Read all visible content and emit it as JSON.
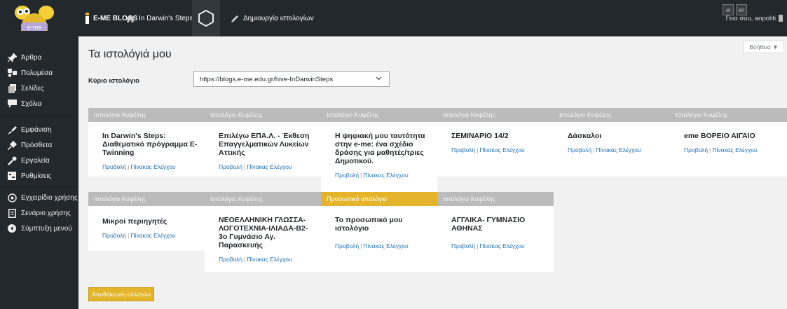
{
  "topbar": {
    "logo_text": "e-me",
    "blogs_label": "E-ME BLOGS",
    "site_label": "In Darwin's Steps: Δ...",
    "create_label": "Δημιουργία ιστολογίων",
    "lang_el": "el",
    "lang_en": "en",
    "greeting": "Γεια σου, anpoliti"
  },
  "sidebar": {
    "items": [
      {
        "label": "Άρθρα",
        "icon": "pin-icon"
      },
      {
        "label": "Πολυμέσα",
        "icon": "media-icon"
      },
      {
        "label": "Σελίδες",
        "icon": "pages-icon"
      },
      {
        "label": "Σχόλια",
        "icon": "comments-icon"
      },
      {
        "label": "Εμφάνιση",
        "icon": "appearance-icon"
      },
      {
        "label": "Πρόσθετα",
        "icon": "plugins-icon"
      },
      {
        "label": "Εργαλεία",
        "icon": "tools-icon"
      },
      {
        "label": "Ρυθμίσεις",
        "icon": "settings-icon"
      },
      {
        "label": "Εγχειρίδιο χρήσης",
        "icon": "help-icon"
      },
      {
        "label": "Σενάριο χρήσης",
        "icon": "scenario-icon"
      },
      {
        "label": "Σύμπτυξη μενού",
        "icon": "collapse-icon"
      }
    ]
  },
  "main": {
    "help_label": "Βοήθεια ▼",
    "title": "Τα ιστολόγιά μου",
    "primary_label": "Κύριο ιστολόγιο",
    "primary_value": "https://blogs.e-me.edu.gr/hive-InDarwinSteps",
    "view_label": "Προβολή",
    "dashboard_label": "Πίνακας Ελέγχου",
    "save_label": "Αποθήκευση αλλαγών",
    "blogs": [
      {
        "header": "Ιστολόγιο Κυψέλης",
        "title": "In Darwin's Steps: Διαθεματικό πρόγραμμα E-Twinning"
      },
      {
        "header": "Ιστολόγιο Κυψέλης",
        "title": "Επιλέγω ΕΠΑ.Λ. - Έκθεση Επαγγελματικών Λυκείων Αττικής"
      },
      {
        "header": "Ιστολόγιο Κυψέλης",
        "title": "Η ψηφιακή μου ταυτότητα στην e-me: ένα σχέδιο δράσης για μαθητές/τριες Δημοτικού."
      },
      {
        "header": "Ιστολόγιο Κυψέλης",
        "title": "ΣΕΜΙΝΑΡΙΟ 14/2"
      },
      {
        "header": "Ιστολόγιο Κυψέλης",
        "title": "Δάσκαλοι"
      },
      {
        "header": "Ιστολόγιο Κυψέλης",
        "title": "eme ΒΟΡΕΙΟ ΑΙΓΑΙΟ"
      },
      {
        "header": "Ιστολόγιο Κυψέλης",
        "title": "Μικροί περιηγητές"
      },
      {
        "header": "Ιστολόγιο Κυψέλης",
        "title": "ΝΕΟΕΛΛΗΝΙΚΗ ΓΛΩΣΣΑ-ΛΟΓΟΤΕΧΝΙΑ-ΙΛΙΑΔΑ-Β2-3ο Γυμνάσιο Αγ. Παρασκευής"
      },
      {
        "header": "Προσωπικό ιστολόγιο",
        "title": "Το προσωπικό μου ιστολόγιο",
        "personal": true
      },
      {
        "header": "Ιστολόγιο Κυψέλης",
        "title": "ΑΓΓΛΙΚΑ- ΓΥΜΝΑΣΙΟ ΑΘΗΝΑΣ"
      }
    ]
  },
  "colors": {
    "bar": "#23282d",
    "accent": "#e4b52a",
    "link": "#2271b1",
    "card_header": "#bbbbbb"
  }
}
